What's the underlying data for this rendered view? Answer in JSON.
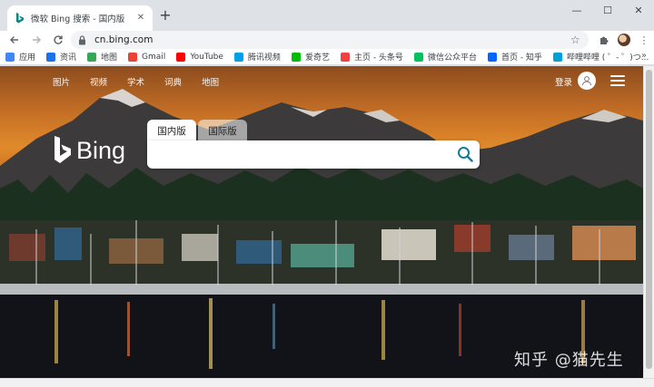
{
  "browser": {
    "tab": {
      "title": "微软 Bing 搜索 - 国内版",
      "favicon": "bing-icon"
    },
    "new_tab_label": "+",
    "window": {
      "minimize": "—",
      "maximize": "☐",
      "close": "✕"
    },
    "url": "cn.bing.com",
    "bookmarks": [
      {
        "label": "应用",
        "icon": "apps-icon",
        "color": "#4285f4"
      },
      {
        "label": "资讯",
        "icon": "news-icon",
        "color": "#1a73e8"
      },
      {
        "label": "地图",
        "icon": "maps-icon",
        "color": "#34a853"
      },
      {
        "label": "Gmail",
        "icon": "gmail-icon",
        "color": "#ea4335"
      },
      {
        "label": "YouTube",
        "icon": "youtube-icon",
        "color": "#ff0000"
      },
      {
        "label": "腾讯视频",
        "icon": "tencent-video-icon",
        "color": "#00a0e9"
      },
      {
        "label": "爱奇艺",
        "icon": "iqiyi-icon",
        "color": "#00be06"
      },
      {
        "label": "主页 - 头条号",
        "icon": "toutiao-icon",
        "color": "#f04142"
      },
      {
        "label": "微信公众平台",
        "icon": "wechat-icon",
        "color": "#07c160"
      },
      {
        "label": "首页 - 知乎",
        "icon": "zhihu-icon",
        "color": "#0066ff"
      },
      {
        "label": "哔哩哔哩 ( ゜- ゜)つ...",
        "icon": "bilibili-icon",
        "color": "#00a1d6"
      }
    ],
    "bookmarks_more": "»"
  },
  "bing": {
    "nav": [
      "图片",
      "视频",
      "学术",
      "词典",
      "地图"
    ],
    "login": "登录",
    "logo_text": "Bing",
    "tabs": {
      "domestic": "国内版",
      "international": "国际版"
    },
    "search_placeholder": ""
  },
  "watermark": "知乎 @猫先生"
}
